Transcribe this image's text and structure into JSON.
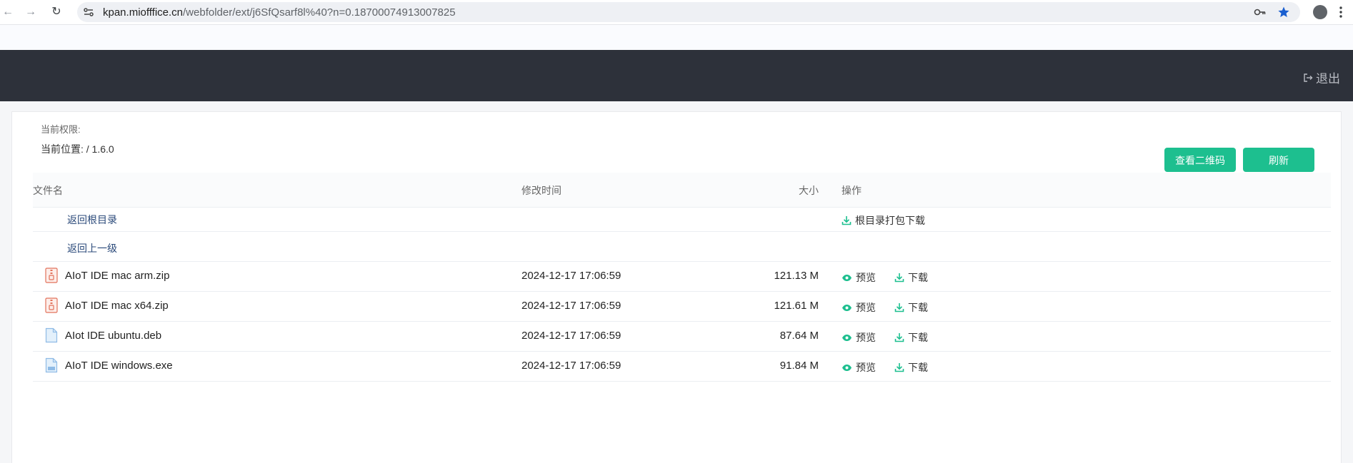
{
  "browser": {
    "url_host": "kpan.miofffice.cn",
    "url_path": "/webfolder/ext/j6SfQsarf8l%40?n=0.18700074913007825"
  },
  "header": {
    "logout_label": "退出"
  },
  "panel": {
    "permission_label": "当前权限:",
    "location_label": "当前位置: ",
    "location_value": "/ 1.6.0",
    "qr_button": "查看二维码",
    "refresh_button": "刷新"
  },
  "table": {
    "columns": [
      "文件名",
      "修改时间",
      "大小",
      "操作"
    ],
    "root_link": "返回根目录",
    "root_download": "根目录打包下载",
    "up_link": "返回上一级",
    "preview_label": "预览",
    "download_label": "下载",
    "rows": [
      {
        "name": "AIoT IDE mac arm.zip",
        "time": "2024-12-17 17:06:59",
        "size": "121.13 M",
        "icon": "zip-file-icon"
      },
      {
        "name": "AIoT IDE mac x64.zip",
        "time": "2024-12-17 17:06:59",
        "size": "121.61 M",
        "icon": "zip-file-icon"
      },
      {
        "name": "AIot IDE ubuntu.deb",
        "time": "2024-12-17 17:06:59",
        "size": "87.64 M",
        "icon": "file-icon"
      },
      {
        "name": "AIoT IDE windows.exe",
        "time": "2024-12-17 17:06:59",
        "size": "91.84 M",
        "icon": "exe-file-icon"
      }
    ]
  },
  "colors": {
    "accent": "#1dbf8f",
    "header_bg": "#2d313a",
    "link": "#2b4a7a"
  }
}
